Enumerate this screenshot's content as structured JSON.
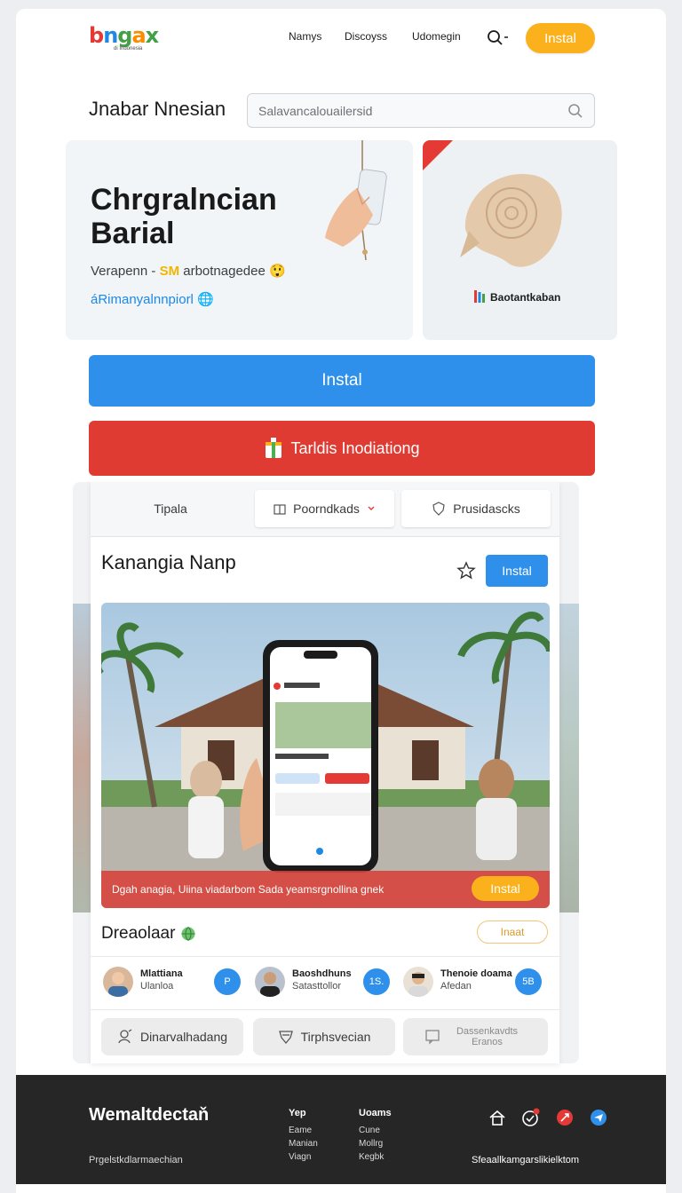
{
  "header": {
    "logo_parts": [
      "b",
      "n",
      "g",
      "a"
    ],
    "logo_mark": "x",
    "logo_sub": "di Indonesia",
    "nav": [
      "Namys",
      "Discoyss",
      "Udomegin"
    ],
    "search_icon": "search-icon",
    "install_label": "Instal"
  },
  "title_row": {
    "title": "Jnabar Nnesian",
    "search_placeholder": "Salavancalouailersid"
  },
  "hero": {
    "title": "Chrgralncian Barial",
    "line1_prefix": "Verapenn - ",
    "line1_highlight": "SM",
    "line1_suffix": " arbotnagedee",
    "line1_emoji": "😲",
    "line2": "áRimanyalnnpiorl",
    "line2_emoji": "🌐",
    "side_label": "Baotantkaban"
  },
  "cta": {
    "install_label": "Instal",
    "red_label": "Tarldis Inodiationg"
  },
  "app_card": {
    "tabs": [
      "Tipala",
      "Poorndkads",
      "Prusidascks"
    ],
    "app_name": "Kanangia Nanp",
    "install_label": "Instal",
    "banner_text": "Dgah anagia, Uiina viadarbom Sada yeamsrgnollina gnek",
    "banner_install": "Instal",
    "section_title": "Dreaolaar",
    "section_button": "Inaat",
    "people": [
      {
        "name": "Mlattiana",
        "sub": "Ulanloa",
        "badge": "P"
      },
      {
        "name": "Baoshdhuns",
        "sub": "Satasttollor",
        "badge": "1S."
      },
      {
        "name": "Thenoie doama",
        "sub": "Afedan",
        "badge": "5B"
      }
    ],
    "actions": [
      "Dinarvalhadang",
      "Tirphsvecian",
      "Dassenkavdts Eranos"
    ]
  },
  "footer": {
    "brand": "Wemaltdectaň",
    "tagline": "Prgelstkdlarmaechian",
    "col1_heading": "Yep",
    "col1_items": [
      "Eame",
      "Manian",
      "Viagn"
    ],
    "col2_heading": "Uoams",
    "col2_items": [
      "Cune",
      "Mollrg",
      "Kegbk"
    ],
    "email": "Sfeaallkamgarslikielktom"
  },
  "colors": {
    "brand_yellow": "#fbb11b",
    "brand_blue": "#2f90ec",
    "brand_red": "#e03b32",
    "footer_bg": "#262626"
  }
}
